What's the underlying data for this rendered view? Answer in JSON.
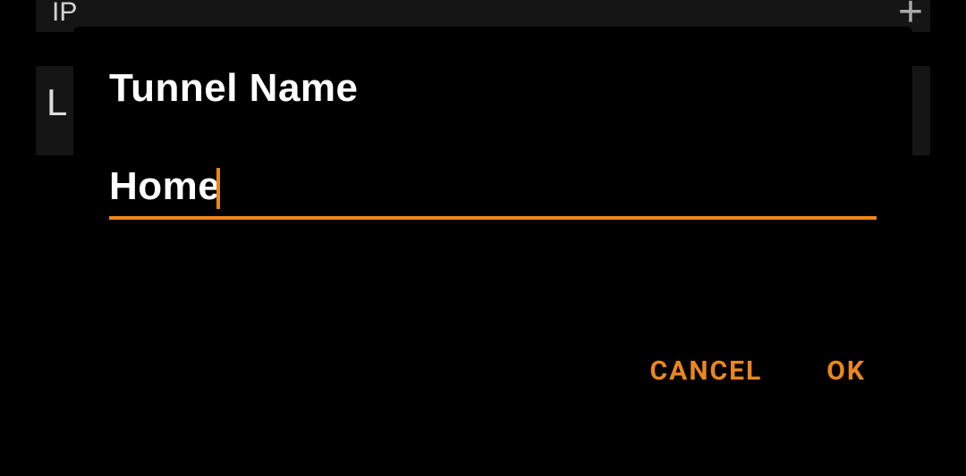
{
  "background": {
    "top_text_fragment": "IP",
    "left_text_fragment": "L",
    "plus_glyph": "+"
  },
  "dialog": {
    "title": "Tunnel Name",
    "input_value": "Home",
    "input_placeholder": "",
    "actions": {
      "cancel": "CANCEL",
      "ok": "OK"
    }
  },
  "colors": {
    "accent": "#E9861F",
    "dialog_bg": "#000000",
    "panel_bg": "#151515",
    "text": "#FFFFFF"
  }
}
